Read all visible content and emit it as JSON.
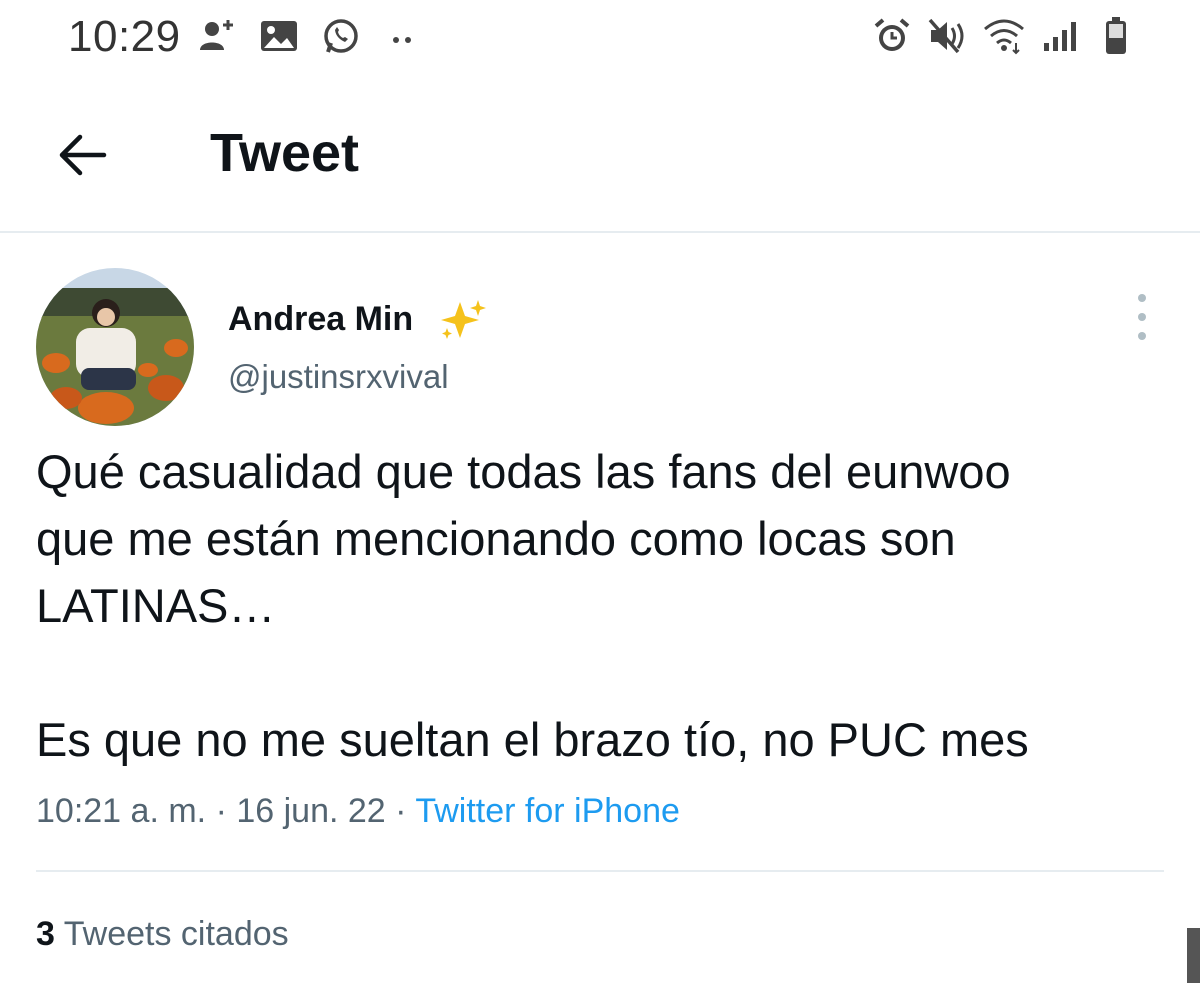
{
  "status_bar": {
    "time": "10:29",
    "left_icons": [
      "add-person-icon",
      "image-icon",
      "whatsapp-icon",
      "more-notifications-icon"
    ],
    "right_icons": [
      "alarm-icon",
      "mute-icon",
      "wifi-icon",
      "signal-icon",
      "battery-icon"
    ]
  },
  "header": {
    "title": "Tweet",
    "back_icon": "arrow-left-icon"
  },
  "tweet": {
    "author_name": "Andrea Min",
    "author_emoji": "✨",
    "author_handle": "@justinsrxvival",
    "text_lines": [
      "Qué casualidad que todas las fans del eunwoo",
      "que me están mencionando como locas son",
      "LATINAS…",
      "Es que no me sueltan el brazo tío, no PUC mes"
    ],
    "time": "10:21 a. m.",
    "date": "16 jun. 22",
    "separator": "·",
    "source": "Twitter for iPhone"
  },
  "quotes": {
    "count": "3",
    "label": "Tweets citados"
  },
  "colors": {
    "text": "#0f1419",
    "secondary": "#536471",
    "accent": "#1d9bf0",
    "divider": "#e6ecf0"
  }
}
